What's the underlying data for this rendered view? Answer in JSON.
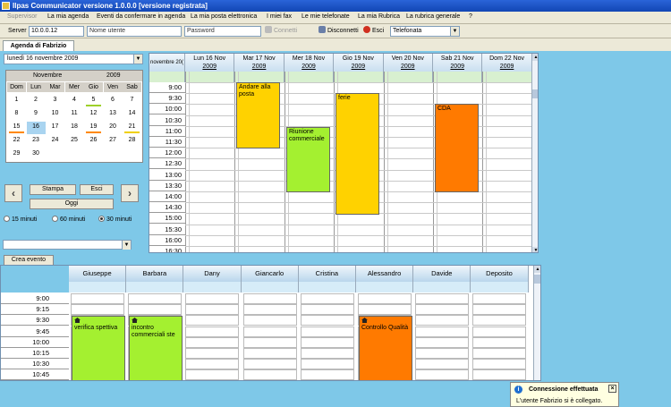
{
  "window": {
    "title": "Ilpas Communicator versione 1.0.0.0 [versione registrata]"
  },
  "menu": {
    "items": [
      {
        "label": "Supervisor",
        "disabled": true
      },
      {
        "label": "La mia agenda"
      },
      {
        "label": "Eventi da confermare in agenda"
      },
      {
        "label": "La mia posta elettronica"
      },
      {
        "label": "I miei fax"
      },
      {
        "label": "Le mie telefonate"
      },
      {
        "label": "La mia Rubrica"
      },
      {
        "label": "La rubrica generale"
      },
      {
        "label": "?"
      }
    ]
  },
  "toolbar": {
    "server_label": "Server",
    "server_value": "10.0.0.12",
    "username_placeholder": "Nome utente",
    "password_placeholder": "Password",
    "connect_label": "Connetti",
    "disconnect_label": "Disconnetti",
    "exit_label": "Esci",
    "phone_value": "Telefonata"
  },
  "tabs": [
    {
      "label": "Agenda di Fabrizio"
    }
  ],
  "left": {
    "date_value": "lunedì   16 novembre 2009",
    "calendar": {
      "month": "Novembre",
      "year": "2009",
      "days_header": [
        "Dom",
        "Lun",
        "Mar",
        "Mer",
        "Gio",
        "Ven",
        "Sab"
      ],
      "weeks": [
        [
          "1",
          "2",
          "3",
          "4",
          "5",
          "6",
          "7"
        ],
        [
          "8",
          "9",
          "10",
          "11",
          "12",
          "13",
          "14"
        ],
        [
          "15",
          "16",
          "17",
          "18",
          "19",
          "20",
          "21"
        ],
        [
          "22",
          "23",
          "24",
          "25",
          "26",
          "27",
          "28"
        ],
        [
          "29",
          "30",
          "",
          "",
          "",
          "",
          ""
        ]
      ]
    },
    "stampa_label": "Stampa",
    "esci_label": "Esci",
    "oggi_label": "Oggi",
    "radio": [
      {
        "label": "15 minuti",
        "checked": false
      },
      {
        "label": "60 minuti",
        "checked": false
      },
      {
        "label": "30 minuti",
        "checked": true
      }
    ]
  },
  "week": {
    "corner": "novembre 20(",
    "days": [
      {
        "label": "Lun 16 Nov",
        "year": "2009"
      },
      {
        "label": "Mar 17 Nov",
        "year": "2009"
      },
      {
        "label": "Mer 18 Nov",
        "year": "2009"
      },
      {
        "label": "Gio 19 Nov",
        "year": "2009"
      },
      {
        "label": "Ven 20 Nov",
        "year": "2009"
      },
      {
        "label": "Sab 21 Nov",
        "year": "2009"
      },
      {
        "label": "Dom 22 Nov",
        "year": "2009"
      }
    ],
    "times": [
      "9:00",
      "9:30",
      "10:00",
      "10:30",
      "11:00",
      "11:30",
      "12:00",
      "12:30",
      "13:00",
      "13:30",
      "14:00",
      "14:30",
      "15:00",
      "15:30",
      "16:00",
      "16:30"
    ],
    "events": [
      {
        "title": "Andare alla posta",
        "color": "#ffd200"
      },
      {
        "title": "Riunione commerciale",
        "color": "#a4f030"
      },
      {
        "title": "ferie",
        "color": "#ffd200"
      },
      {
        "title": "CDA",
        "color": "#ff7a00"
      }
    ]
  },
  "bottom": {
    "crea_label": "Crea evento",
    "resources": [
      "Giuseppe",
      "Barbara",
      "Dany",
      "Giancarlo",
      "Cristina",
      "Alessandro",
      "Davide",
      "Deposito"
    ],
    "times": [
      "9:00",
      "9:15",
      "9:30",
      "9:45",
      "10:00",
      "10:15",
      "10:30",
      "10:45"
    ],
    "events": [
      {
        "title": "verifica spettiva",
        "color": "#a4f030"
      },
      {
        "title": "incontro commerciali ste",
        "color": "#a4f030"
      },
      {
        "title": "Controllo Qualità",
        "color": "#ff7a00"
      }
    ]
  },
  "notification": {
    "title": "Connessione effettuata",
    "message": "L'utente Fabrizio si è collegato."
  }
}
